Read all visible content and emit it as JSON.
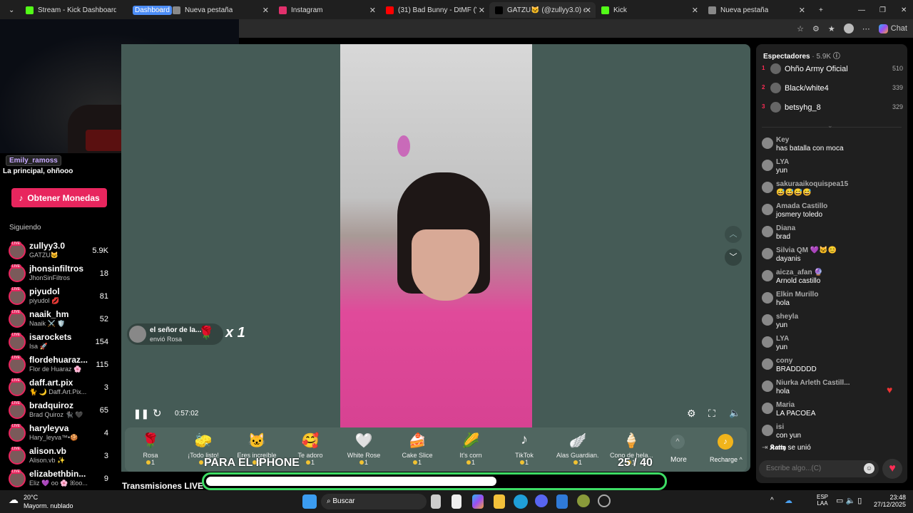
{
  "tabs": [
    {
      "label": "Stream - Kick Dashboard",
      "color": "#53fc18"
    },
    {
      "label": "Dashboard",
      "color": "#4c8df6"
    },
    {
      "label": "Nueva pestaña",
      "color": "#888"
    },
    {
      "label": "Instagram",
      "color": "#e1306c"
    },
    {
      "label": "(31) Bad Bunny - DtMF (Vid",
      "color": "#ff0000"
    },
    {
      "label": "GATZU🐱 (@zullyy3.0) est",
      "color": "#000"
    },
    {
      "label": "Kick",
      "color": "#53fc18"
    },
    {
      "label": "Nueva pestaña",
      "color": "#888"
    }
  ],
  "toolbar": {
    "chat_label": "Chat"
  },
  "sidebar": {
    "user_chip": "Emily_ramoss",
    "caption": "La principal, ohñooo",
    "coins_button": "Obtener Monedas",
    "following_title": "Siguiendo",
    "following": [
      {
        "name": "zullyy3.0",
        "sub": "GATZU🐱",
        "count": "5.9K"
      },
      {
        "name": "jhonsinfiltros",
        "sub": "JhonSinFiltros",
        "count": "18"
      },
      {
        "name": "piyudol",
        "sub": "piyudol 💋",
        "count": "81"
      },
      {
        "name": "naaik_hm",
        "sub": "Naaik ⚔️ 🛡️",
        "count": "52"
      },
      {
        "name": "isarockets",
        "sub": "Isa 🚀",
        "count": "154"
      },
      {
        "name": "flordehuaraz...",
        "sub": "Flor de Huaraz 🌸",
        "count": "115"
      },
      {
        "name": "daff.art.pix",
        "sub": "🐈 🌙 Daff.Art.Pix...",
        "count": "3"
      },
      {
        "name": "bradquiroz",
        "sub": "Brad Quiroz 🐈‍⬛ 🖤",
        "count": "65"
      },
      {
        "name": "haryleyva",
        "sub": "Hary_leyva™•🍪",
        "count": "4"
      },
      {
        "name": "alison.vb",
        "sub": "Alison.vb ✨",
        "count": "3"
      },
      {
        "name": "elizabethbin...",
        "sub": "Eliz 💜 oo 🌸 ꕤoo...",
        "count": "9"
      }
    ],
    "recommended_title": "Transmisiones LIVE recomendadas"
  },
  "player": {
    "gift_sender": "el señor de la...",
    "gift_action": "envió Rosa",
    "gift_multiplier": "x 1",
    "time": "0:57:02",
    "overlay_text": "PARA EL IPHONE",
    "goal_counter": "25 / 40",
    "goal_progress": 0.63,
    "goal_color": "#3ddc64"
  },
  "gifts": [
    {
      "name": "Rosa",
      "icon": "🌹",
      "cost": "1"
    },
    {
      "name": "¡Todo listo!",
      "icon": "🧽",
      "cost": "1"
    },
    {
      "name": "Eres increíble",
      "icon": "🐱",
      "cost": "1"
    },
    {
      "name": "Te adoro",
      "icon": "🥰",
      "cost": "1"
    },
    {
      "name": "White Rose",
      "icon": "🤍",
      "cost": "1"
    },
    {
      "name": "Cake Slice",
      "icon": "🍰",
      "cost": "1"
    },
    {
      "name": "It's corn",
      "icon": "🌽",
      "cost": "1"
    },
    {
      "name": "TikTok",
      "icon": "♪",
      "cost": "1"
    },
    {
      "name": "Alas Guardian...",
      "icon": "🪽",
      "cost": "1"
    },
    {
      "name": "Cono de hela...",
      "icon": "🍦",
      "cost": "1"
    }
  ],
  "gift_more": "More",
  "recharge": "Recharge ^",
  "viewers": {
    "title": "Espectadores",
    "count": "· 5.9K",
    "top": [
      {
        "rank": "1",
        "name": "Ohño Army Oficial",
        "score": "510"
      },
      {
        "rank": "2",
        "name": "Black/white4",
        "score": "339"
      },
      {
        "rank": "3",
        "name": "betsyhg_8",
        "score": "329"
      }
    ]
  },
  "chat": [
    {
      "user": "Key",
      "text": "has batalla con moca"
    },
    {
      "user": "LYA",
      "text": "yun"
    },
    {
      "user": "sakuraaikoquispea15",
      "text": "😅😅😅😅"
    },
    {
      "user": "Amada Castillo",
      "text": "josmery toledo"
    },
    {
      "user": "Diana",
      "text": "brad"
    },
    {
      "user": "Silvia QM 💜🐱😊",
      "text": "dayanis"
    },
    {
      "user": "aicza_afan 🔮",
      "text": "Arnold castillo"
    },
    {
      "user": "Elkin Murillo",
      "text": "hola"
    },
    {
      "user": "sheyla",
      "text": "yun"
    },
    {
      "user": "LYA",
      "text": "yun"
    },
    {
      "user": "cony",
      "text": "BRADDDDD"
    },
    {
      "user": "Niurka Arleth Castill...",
      "text": "hola"
    },
    {
      "user": "Maria",
      "text": "LA PACOEA"
    },
    {
      "user": "isi",
      "text": "con yun"
    }
  ],
  "join": {
    "user": "𝕶𝖆𝖙𝖙𝖞",
    "text": "se unió"
  },
  "chat_input": {
    "placeholder": "Escribe algo...(C)"
  },
  "taskbar": {
    "temp": "20°C",
    "weather": "Mayorm. nublado",
    "search": "Buscar",
    "lang1": "ESP",
    "lang2": "LAA",
    "time": "23:48",
    "date": "27/12/2025"
  }
}
